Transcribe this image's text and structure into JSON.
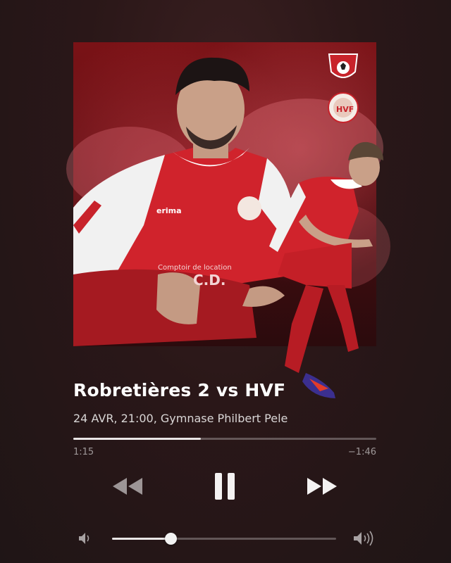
{
  "track": {
    "title": "Robretières 2 vs HVF",
    "subtitle": "24 AVR, 21:00, Gymnase Philbert Pele"
  },
  "playback": {
    "elapsed": "1:15",
    "remaining": "−1:46",
    "progress_fraction": 0.42,
    "state": "playing"
  },
  "volume": {
    "level_fraction": 0.26
  },
  "artwork": {
    "jersey_brand": "erima",
    "sponsor_line1": "Comptoir de location",
    "sponsor_line2": "C.D.",
    "badge_2_text": "HVF"
  },
  "colors": {
    "background": "#2a1718",
    "accent_red": "#c8232b",
    "track_fill": "#e9e6e6"
  },
  "controls": {
    "rewind_icon": "rewind-icon",
    "pause_icon": "pause-icon",
    "forward_icon": "fast-forward-icon",
    "volume_low_icon": "volume-low-icon",
    "volume_high_icon": "volume-high-icon"
  }
}
